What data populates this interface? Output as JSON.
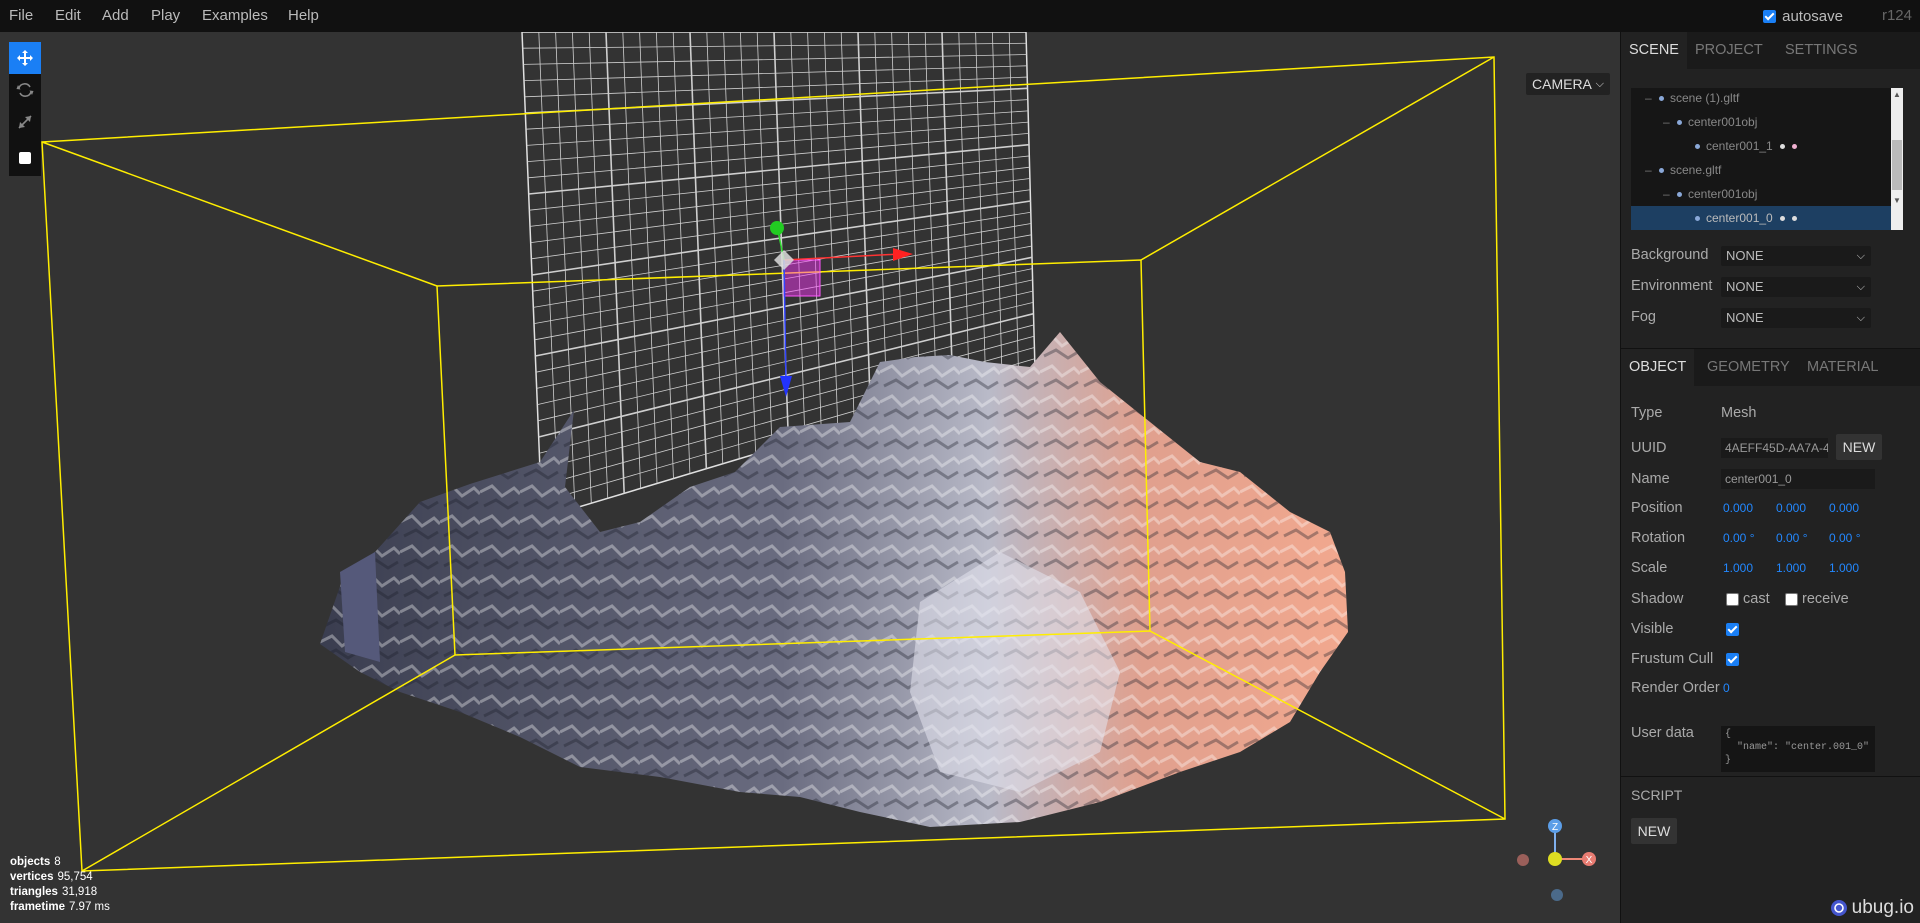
{
  "menubar": {
    "items": [
      "File",
      "Edit",
      "Add",
      "Play",
      "Examples",
      "Help"
    ],
    "autosave_label": "autosave",
    "autosave_checked": true,
    "version": "r124"
  },
  "viewport": {
    "camera_select": "CAMERA",
    "info": {
      "objects_label": "objects",
      "objects": "8",
      "vertices_label": "vertices",
      "vertices": "95,754",
      "triangles_label": "triangles",
      "triangles": "31,918",
      "frametime_label": "frametime",
      "frametime": "7.97 ms"
    },
    "gizmo_axes": [
      "Z",
      "X"
    ]
  },
  "sidebar": {
    "tabs": [
      "SCENE",
      "PROJECT",
      "SETTINGS"
    ],
    "outliner": [
      {
        "label": "scene (1).gltf",
        "opener": "–",
        "dots": []
      },
      {
        "label": "center001obj",
        "opener": "–",
        "dots": []
      },
      {
        "label": "center001_1",
        "opener": "",
        "dots": [
          "white",
          "pink"
        ]
      },
      {
        "label": "scene.gltf",
        "opener": "–",
        "dots": []
      },
      {
        "label": "center001obj",
        "opener": "–",
        "dots": []
      },
      {
        "label": "center001_0",
        "opener": "",
        "dots": [
          "white",
          "white"
        ],
        "selected": true
      }
    ],
    "background_label": "Background",
    "background_value": "NONE",
    "environment_label": "Environment",
    "environment_value": "NONE",
    "fog_label": "Fog",
    "fog_value": "NONE",
    "object_tabs": [
      "OBJECT",
      "GEOMETRY",
      "MATERIAL"
    ],
    "object": {
      "type_label": "Type",
      "type_value": "Mesh",
      "uuid_label": "UUID",
      "uuid_value": "4AEFF45D-AA7A-4",
      "uuid_new": "NEW",
      "name_label": "Name",
      "name_value": "center001_0",
      "position_label": "Position",
      "position": [
        "0.000",
        "0.000",
        "0.000"
      ],
      "rotation_label": "Rotation",
      "rotation": [
        "0.00 °",
        "0.00 °",
        "0.00 °"
      ],
      "scale_label": "Scale",
      "scale": [
        "1.000",
        "1.000",
        "1.000"
      ],
      "shadow_label": "Shadow",
      "cast_label": "cast",
      "receive_label": "receive",
      "cast_checked": false,
      "receive_checked": false,
      "visible_label": "Visible",
      "visible_checked": true,
      "frustum_label": "Frustum Cull",
      "frustum_checked": true,
      "render_order_label": "Render Order",
      "render_order": "0",
      "userdata_label": "User data",
      "userdata": "{\n  \"name\": \"center.001_0\"\n}"
    },
    "script_label": "SCRIPT",
    "script_new": "NEW",
    "footer_logo": "ubug.io"
  },
  "colors": {
    "accent": "#1a7ff5",
    "bbox": "#ffee00",
    "x_axis": "#ff3333",
    "y_axis": "#33dd33",
    "z_axis": "#3344ff"
  }
}
